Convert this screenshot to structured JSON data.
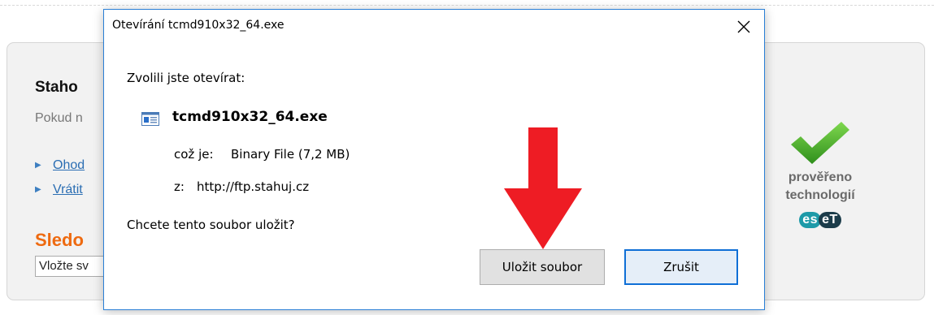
{
  "page": {
    "title": "Staho",
    "subtitle": "Pokud n",
    "links": [
      "Ohod",
      "Vrátit"
    ],
    "follow_title": "Sledo",
    "follow_input_value": "Vložte sv"
  },
  "eset": {
    "line1": "prověřeno",
    "line2": "technologií",
    "logo_es": "es",
    "logo_et": "eT"
  },
  "dialog": {
    "title": "Otevírání tcmd910x32_64.exe",
    "intro": "Zvolili jste otevírat:",
    "file_name": "tcmd910x32_64.exe",
    "type_label": "což je:",
    "type_value": "Binary File (7,2 MB)",
    "from_label": "z:",
    "from_value": "http://ftp.stahuj.cz",
    "question": "Chcete tento soubor uložit?",
    "save_label": "Uložit soubor",
    "cancel_label": "Zrušit"
  },
  "colors": {
    "accent_blue": "#0f6fd6",
    "arrow_red": "#ee1c24",
    "orange": "#ee6a10",
    "check_green": "#4caf2a"
  },
  "icons": [
    "close-icon",
    "file-icon",
    "checkmark-icon",
    "red-arrow"
  ]
}
